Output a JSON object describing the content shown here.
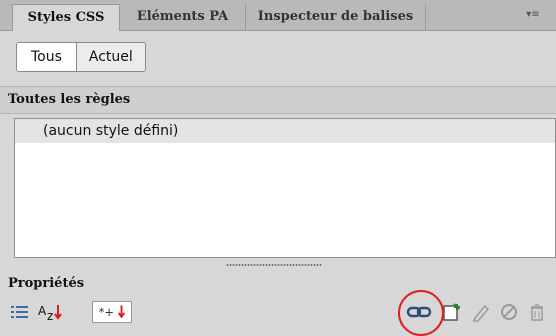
{
  "tabs": [
    {
      "label": "Styles CSS",
      "active": true
    },
    {
      "label": "Eléments PA",
      "active": false
    },
    {
      "label": "Inspecteur de balises",
      "active": false
    }
  ],
  "panel_menu_icon": "panel-menu-icon",
  "mode_toggle": {
    "all": "Tous",
    "current": "Actuel",
    "selected": "Tous"
  },
  "rules_section": {
    "title": "Toutes les règles"
  },
  "rules": [
    {
      "text": "(aucun style défini)"
    }
  ],
  "properties": {
    "title": "Propriétés"
  },
  "toolbar": {
    "categories_icon": "category-view-icon",
    "alpha_icon": "alphabetical-view-icon",
    "set_props_icon": "set-properties-icon",
    "attach_icon": "attach-stylesheet-icon",
    "new_rule_icon": "new-css-rule-icon",
    "edit_icon": "edit-style-icon",
    "disable_icon": "disable-css-property-icon",
    "delete_icon": "delete-css-rule-icon"
  },
  "colors": {
    "highlight_circle": "#e11d1d"
  }
}
